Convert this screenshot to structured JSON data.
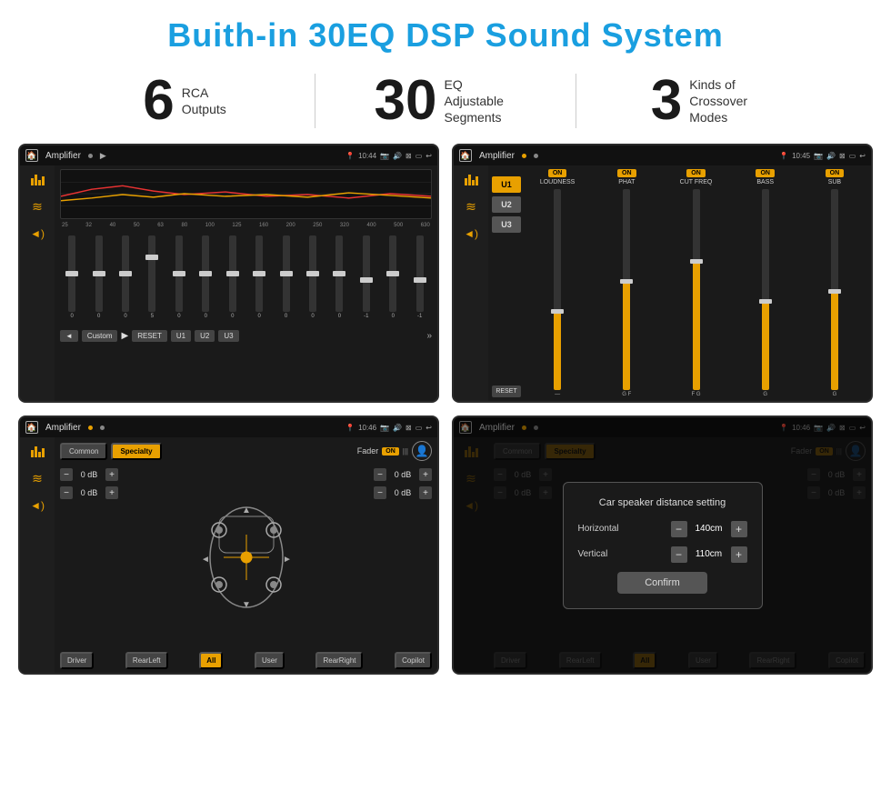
{
  "page": {
    "title": "Buith-in 30EQ DSP Sound System",
    "stats": [
      {
        "number": "6",
        "label": "RCA\nOutputs"
      },
      {
        "number": "30",
        "label": "EQ Adjustable\nSegments"
      },
      {
        "number": "3",
        "label": "Kinds of\nCrossover Modes"
      }
    ],
    "screens": [
      {
        "id": "screen-eq",
        "topbar": {
          "title": "Amplifier",
          "time": "10:44"
        },
        "type": "eq"
      },
      {
        "id": "screen-amp",
        "topbar": {
          "title": "Amplifier",
          "time": "10:45"
        },
        "type": "amp"
      },
      {
        "id": "screen-fader",
        "topbar": {
          "title": "Amplifier",
          "time": "10:46"
        },
        "type": "fader"
      },
      {
        "id": "screen-dialog",
        "topbar": {
          "title": "Amplifier",
          "time": "10:46"
        },
        "type": "dialog"
      }
    ],
    "eq": {
      "frequencies": [
        "25",
        "32",
        "40",
        "50",
        "63",
        "80",
        "100",
        "125",
        "160",
        "200",
        "250",
        "320",
        "400",
        "500",
        "630"
      ],
      "values": [
        "0",
        "0",
        "0",
        "5",
        "0",
        "0",
        "0",
        "0",
        "0",
        "0",
        "0",
        "-1",
        "0",
        "-1"
      ],
      "presets": [
        "Custom"
      ],
      "buttons": [
        "RESET",
        "U1",
        "U2",
        "U3"
      ]
    },
    "amp": {
      "presets": [
        "U1",
        "U2",
        "U3"
      ],
      "controls": [
        "LOUDNESS",
        "PHAT",
        "CUT FREQ",
        "BASS",
        "SUB"
      ],
      "toggle_label": "ON",
      "reset": "RESET"
    },
    "fader": {
      "tabs": [
        "Common",
        "Specialty"
      ],
      "active_tab": "Specialty",
      "fader_label": "Fader",
      "on_label": "ON",
      "db_values": [
        "0 dB",
        "0 dB",
        "0 dB",
        "0 dB"
      ],
      "bottom_buttons": [
        "Driver",
        "RearLeft",
        "All",
        "User",
        "RearRight",
        "Copilot"
      ]
    },
    "dialog": {
      "title": "Car speaker distance setting",
      "horizontal_label": "Horizontal",
      "horizontal_value": "140cm",
      "vertical_label": "Vertical",
      "vertical_value": "110cm",
      "confirm_label": "Confirm",
      "minus_label": "−",
      "plus_label": "+"
    }
  }
}
